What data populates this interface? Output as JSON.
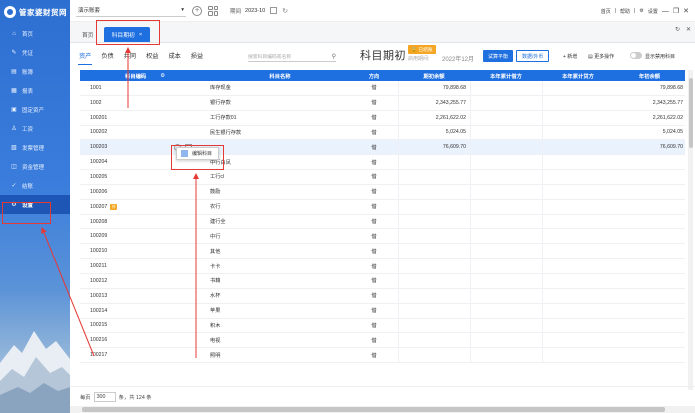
{
  "app": {
    "logo_text": "管家婆财贸网"
  },
  "sidebar": {
    "items": [
      {
        "label": "首页",
        "icon": "home-icon",
        "glyph": "⌂"
      },
      {
        "label": "凭证",
        "icon": "voucher-icon",
        "glyph": "✎"
      },
      {
        "label": "账簿",
        "icon": "ledger-icon",
        "glyph": "▤"
      },
      {
        "label": "报表",
        "icon": "report-icon",
        "glyph": "▦"
      },
      {
        "label": "固定资产",
        "icon": "asset-icon",
        "glyph": "▣"
      },
      {
        "label": "工资",
        "icon": "salary-icon",
        "glyph": "♙"
      },
      {
        "label": "发票管理",
        "icon": "invoice-icon",
        "glyph": "▧"
      },
      {
        "label": "资金管理",
        "icon": "fund-icon",
        "glyph": "◫"
      },
      {
        "label": "结账",
        "icon": "closing-icon",
        "glyph": "✓"
      },
      {
        "label": "设置",
        "icon": "gear-icon",
        "glyph": "⚙"
      }
    ],
    "active_index": 9
  },
  "topbar": {
    "account": "演示账套",
    "period_label": "期间",
    "period_value": "2023-10",
    "links": [
      "首页",
      "帮助",
      "设置"
    ],
    "window_buttons": [
      "—",
      "❐",
      "✕"
    ]
  },
  "tabstrip": {
    "home_label": "首页",
    "active_tab": "科目期初",
    "close_glyph": "×",
    "right_icons": [
      "↻",
      "✕"
    ]
  },
  "toolbar": {
    "categories": [
      "资产",
      "负债",
      "共同",
      "权益",
      "成本",
      "损益"
    ],
    "active_category": 0,
    "search_placeholder": "搜索科目编码或名称",
    "page_title": "科目期初",
    "initialized_badge": "已结账",
    "period_label": "启用期间:",
    "period_value": "2022年12月",
    "trial_balance_label": "试算平衡",
    "data_import_label": "数据/外币",
    "add_label": "+ 新增",
    "more_label": "更多操作",
    "toggle_label": "显示禁用科目"
  },
  "table": {
    "columns": [
      "科目编码",
      "科目名称",
      "方向",
      "期初余额",
      "本年累计借方",
      "本年累计贷方",
      "年初余额"
    ],
    "rows": [
      {
        "code": "1001",
        "name": "库存现金",
        "dir": "借",
        "opening": "79,898.68",
        "year_begin": "79,898.68"
      },
      {
        "code": "1002",
        "name": "银行存款",
        "dir": "借",
        "opening": "2,343,255.77",
        "year_begin": "2,343,255.77"
      },
      {
        "code": "100201",
        "name": "工行存款01",
        "dir": "借",
        "opening": "2,261,622.02",
        "year_begin": "2,261,622.02"
      },
      {
        "code": "100202",
        "name": "民生银行存款",
        "dir": "借",
        "opening": "5,024.05",
        "year_begin": "5,024.05"
      },
      {
        "code": "100203",
        "name": "",
        "dir": "借",
        "opening": "76,609.70",
        "year_begin": "76,609.70"
      },
      {
        "code": "100204",
        "name": "中行白凤",
        "dir": "借",
        "opening": "",
        "year_begin": ""
      },
      {
        "code": "100205",
        "name": "工行cl",
        "dir": "借",
        "opening": "",
        "year_begin": ""
      },
      {
        "code": "100206",
        "name": "鼓励",
        "dir": "借",
        "opening": "",
        "year_begin": ""
      },
      {
        "code": "100207",
        "name": "农行",
        "dir": "借",
        "opening": "",
        "year_begin": "",
        "badge": "外"
      },
      {
        "code": "100208",
        "name": "建行全",
        "dir": "借",
        "opening": "",
        "year_begin": ""
      },
      {
        "code": "100209",
        "name": "中行",
        "dir": "借",
        "opening": "",
        "year_begin": ""
      },
      {
        "code": "100210",
        "name": "其他",
        "dir": "借",
        "opening": "",
        "year_begin": ""
      },
      {
        "code": "100211",
        "name": "卡卡",
        "dir": "借",
        "opening": "",
        "year_begin": ""
      },
      {
        "code": "100212",
        "name": "书籍",
        "dir": "借",
        "opening": "",
        "year_begin": ""
      },
      {
        "code": "100213",
        "name": "水杯",
        "dir": "借",
        "opening": "",
        "year_begin": ""
      },
      {
        "code": "100214",
        "name": "苹果",
        "dir": "借",
        "opening": "",
        "year_begin": ""
      },
      {
        "code": "100215",
        "name": "积木",
        "dir": "借",
        "opening": "",
        "year_begin": ""
      },
      {
        "code": "100216",
        "name": "电视",
        "dir": "借",
        "opening": "",
        "year_begin": ""
      },
      {
        "code": "100217",
        "name": "照明",
        "dir": "借",
        "opening": "",
        "year_begin": ""
      }
    ],
    "popup_label": "编辑科目"
  },
  "footer": {
    "per_page_label": "每页",
    "per_page_value": "300",
    "summary": "条，共 124 条"
  },
  "colors": {
    "accent": "#1e6fe0",
    "annotation": "#e53935",
    "badge": "#f5a623"
  }
}
